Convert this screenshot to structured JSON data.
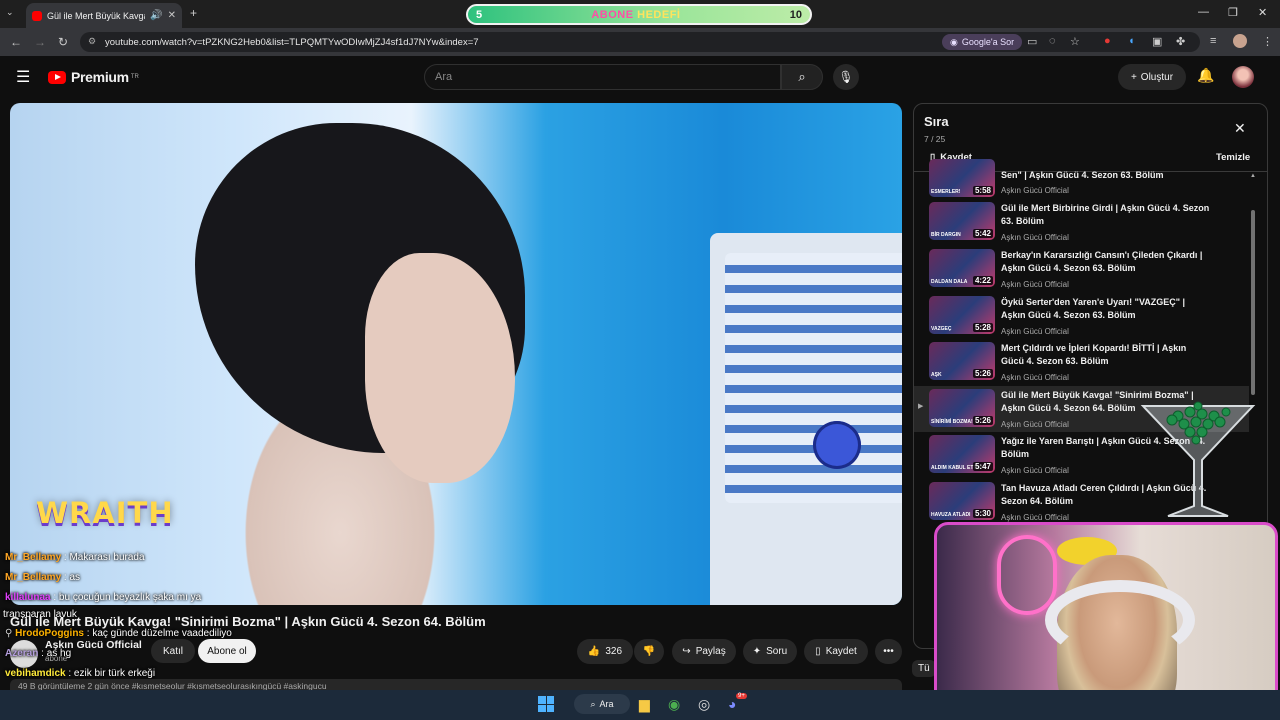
{
  "browser": {
    "tab_title": "Gül ile Mert Büyük Kavga! \"S",
    "url": "youtube.com/watch?v=tPZKNG2Heb0&list=TLPQMTYwODIwMjZJ4sf1dJ7NYw&index=7",
    "google_ask": "Google'a Sor"
  },
  "goal": {
    "start": "5",
    "label_a": "ABONE",
    "label_b": "HEDEFİ",
    "end": "10"
  },
  "header": {
    "brand": "Premium",
    "region": "TR",
    "search_placeholder": "Ara",
    "create": "Oluştur"
  },
  "overlay": {
    "brand_text": "WRAITH"
  },
  "chat": [
    {
      "user": "Mr_Bellamy",
      "color": "#ffa726",
      "msg": " : Makarası burada"
    },
    {
      "user": "Mr_Bellamy",
      "color": "#ffa726",
      "msg": " : as"
    },
    {
      "user": "killalunaa",
      "color": "#e040fb",
      "msg": " : bu çocuğun beyazlık şaka mı ya"
    },
    {
      "user": "",
      "color": "#ffffff",
      "msg": "transparan lavuk"
    },
    {
      "user": "HrodoPoggins",
      "color": "#ffb300",
      "msg": " : kaç günde düzelme vaadediliyo"
    },
    {
      "user": "Azeran",
      "color": "#b39ddb",
      "msg": " : as hg"
    },
    {
      "user": "vebihamdick",
      "color": "#ffeb3b",
      "msg": " : ezik bir türk erkeği"
    }
  ],
  "video": {
    "title": "Gül ile Mert Büyük Kavga! \"Sinirimi Bozma\" | Aşkın Gücü 4. Sezon 64. Bölüm",
    "channel": "Aşkın Gücü Official",
    "subs": "abone",
    "join": "Katıl",
    "subscribe": "Abone ol",
    "likes": "326",
    "share": "Paylaş",
    "ask": "Soru",
    "save": "Kaydet",
    "description": "49 B görüntüleme  2 gün önce  #kısmetseolur #kısmetseolurasıkıngücü #askingucu"
  },
  "playlist": {
    "title": "Sıra",
    "count": "7 / 25",
    "save": "Kaydet",
    "clear": "Temizle",
    "items": [
      {
        "title": "Sen\" | Aşkın Gücü 4. Sezon 63. Bölüm",
        "channel": "Aşkın Gücü Official",
        "duration": "5:58",
        "cap": "ESMERLER!"
      },
      {
        "title": "Gül ile Mert Birbirine Girdi | Aşkın Gücü 4. Sezon 63. Bölüm",
        "channel": "Aşkın Gücü Official",
        "duration": "5:42",
        "cap": "BİR DARGIN"
      },
      {
        "title": "Berkay'ın Kararsızlığı Cansın'ı Çileden Çıkardı | Aşkın Gücü 4. Sezon 63. Bölüm",
        "channel": "Aşkın Gücü Official",
        "duration": "4:22",
        "cap": "DALDAN DALA"
      },
      {
        "title": "Öykü Serter'den Yaren'e Uyarı! \"VAZGEÇ\" | Aşkın Gücü 4. Sezon 63. Bölüm",
        "channel": "Aşkın Gücü Official",
        "duration": "5:28",
        "cap": "VAZGEÇ"
      },
      {
        "title": "Mert Çıldırdı ve İpleri Kopardı! BİTTİ | Aşkın Gücü 4. Sezon 63. Bölüm",
        "channel": "Aşkın Gücü Official",
        "duration": "5:26",
        "cap": "AŞK"
      },
      {
        "title": "Gül ile Mert Büyük Kavga! \"Sinirimi Bozma\" | Aşkın Gücü 4. Sezon 64. Bölüm",
        "channel": "Aşkın Gücü Official",
        "duration": "5:26",
        "cap": "SİNİRİMİ BOZMA!"
      },
      {
        "title": "Yağız ile Yaren Barıştı | Aşkın Gücü 4. Sezon 64. Bölüm",
        "channel": "Aşkın Gücü Official",
        "duration": "5:47",
        "cap": "ALDIM KABUL ETTİM"
      },
      {
        "title": "Tan Havuza Atladı Ceren Çıldırdı | Aşkın Gücü 4. Sezon 64. Bölüm",
        "channel": "Aşkın Gücü Official",
        "duration": "5:30",
        "cap": "HAVUZA ATLADI"
      }
    ]
  },
  "partial_panel": "Tü",
  "taskbar": {
    "search": "Ara",
    "badge": "9+"
  }
}
